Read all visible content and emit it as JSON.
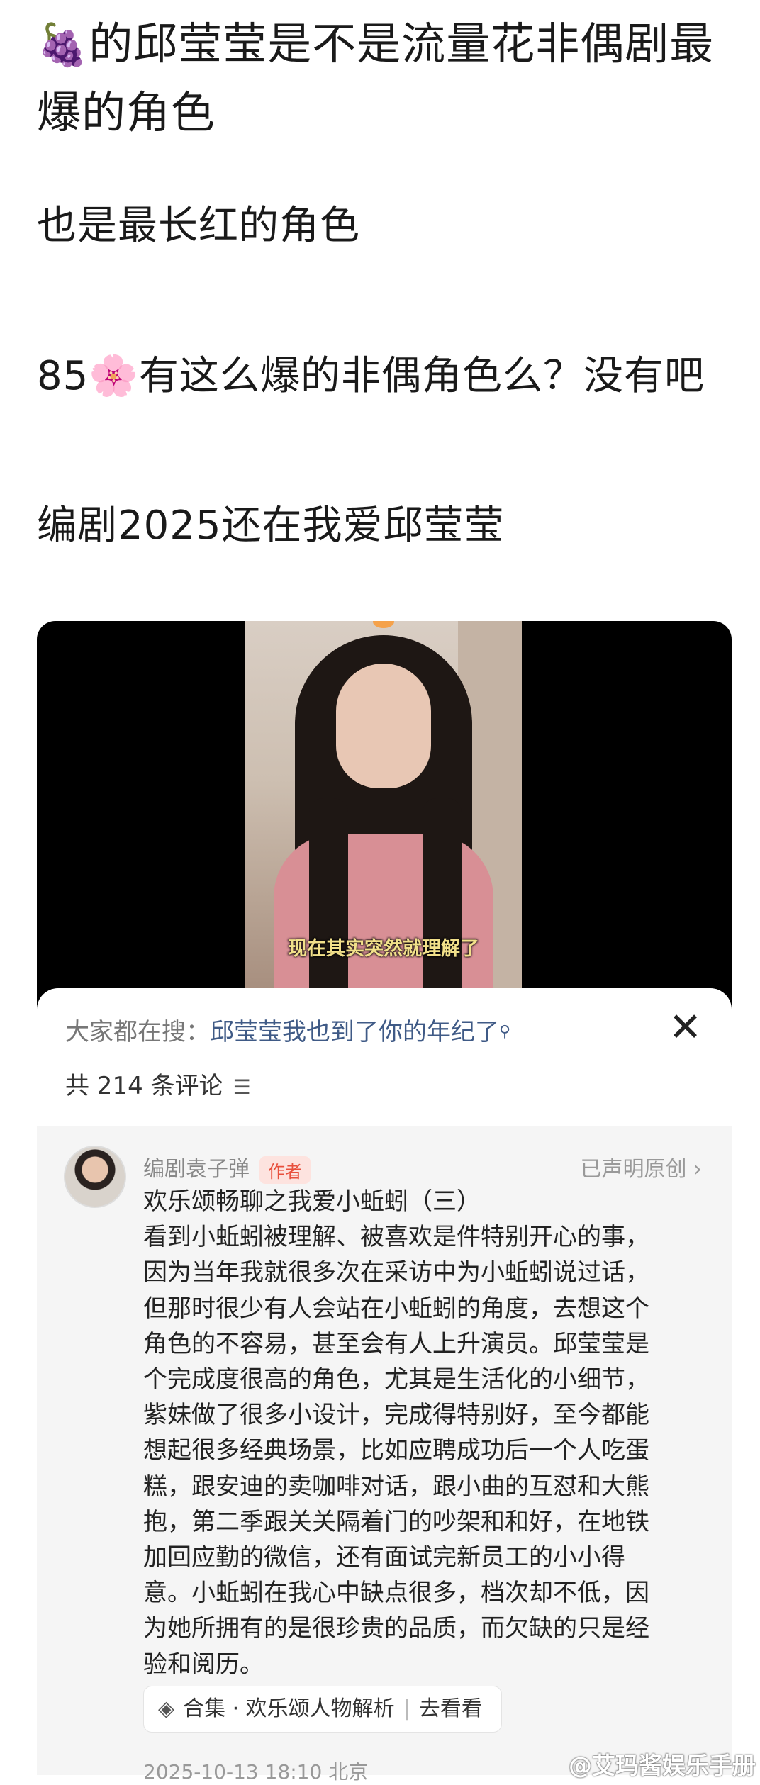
{
  "post": {
    "title_emoji": "🍇",
    "title": "的邱莹莹是不是流量花非偶剧最爆的角色",
    "para1": "也是最长红的角色",
    "para2_prefix": "85",
    "para2_emoji": "🌸",
    "para2_suffix": "有这么爆的非偶角色么？没有吧",
    "para3": "编剧2025还在我爱邱莹莹"
  },
  "video": {
    "subtitle": "现在其实突然就理解了"
  },
  "sheet": {
    "hot_search_label": "大家都在搜：",
    "hot_search_term": "邱莹莹我也到了你的年纪了",
    "close_icon": "✕",
    "comment_count": "共 214 条评论",
    "comment": {
      "author": "编剧袁子弹",
      "badge": "作者",
      "declared": "已声明原创 ›",
      "text": "欢乐颂畅聊之我爱小蚯蚓（三）\n看到小蚯蚓被理解、被喜欢是件特别开心的事，\n因为当年我就很多次在采访中为小蚯蚓说过话，\n但那时很少有人会站在小蚯蚓的角度，去想这个\n角色的不容易，甚至会有人上升演员。邱莹莹是\n个完成度很高的角色，尤其是生活化的小细节，\n紫妹做了很多小设计，完成得特别好，至今都能\n想起很多经典场景，比如应聘成功后一个人吃蛋\n糕，跟安迪的卖咖啡对话，跟小曲的互怼和大熊\n抱，第二季跟关关隔着门的吵架和和好，在地铁\n加回应勤的微信，还有面试完新员工的小小得\n意。小蚯蚓在我心中缺点很多，档次却不低，因\n为她所拥有的是很珍贵的品质，而欠缺的只是经\n验和阅历。",
      "collection_label": "合集 · 欢乐颂人物解析",
      "collection_action": "去看看",
      "timestamp": "2025-10-13 18:10 北京"
    }
  },
  "watermark": "@艾玛酱娱乐手册"
}
